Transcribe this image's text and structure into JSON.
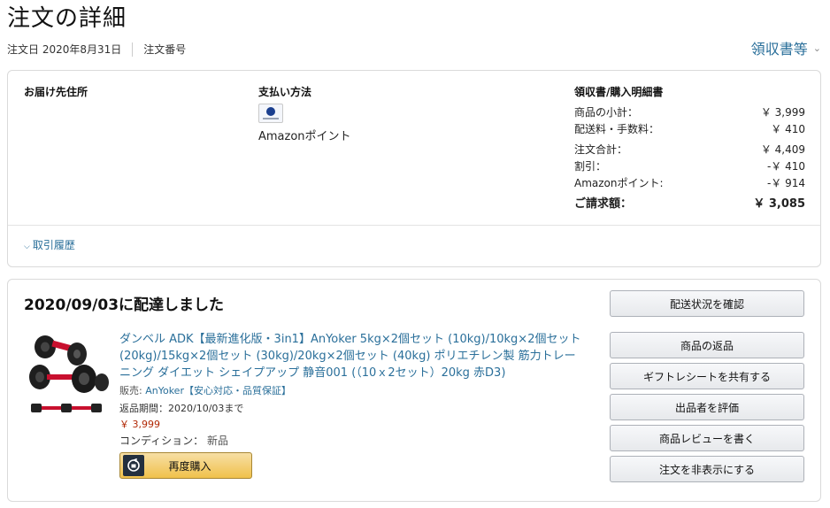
{
  "header": {
    "title": "注文の詳細",
    "order_date_label": "注文日",
    "order_date": "2020年8月31日",
    "order_number_label": "注文番号",
    "receipt_link": "領収書等"
  },
  "summary": {
    "shipping_address_label": "お届け先住所",
    "payment_method_label": "支払い方法",
    "payment_method": "Amazonポイント",
    "payment_icon": "card-icon",
    "receipt_heading": "領収書/購入明細書",
    "rows": [
      {
        "label": "商品の小計：",
        "value": "￥ 3,999"
      },
      {
        "label": "配送料・手数料：",
        "value": "￥ 410"
      },
      {
        "label": "注文合計：",
        "value": "￥ 4,409"
      },
      {
        "label": "割引：",
        "value": "-￥ 410"
      },
      {
        "label": "Amazonポイント:",
        "value": "-￥ 914"
      }
    ],
    "grand_total_label": "ご請求額：",
    "grand_total": "￥ 3,085",
    "history_link": "取引履歴"
  },
  "shipment": {
    "status": "2020/09/03に配達しました",
    "product": {
      "title": "ダンベル ADK【最新進化版・3in1】AnYoker 5kg×2個セット (10kg)/10kg×2個セット (20kg)/15kg×2個セット (30kg)/20kg×2個セット (40kg) ポリエチレン製 筋力トレーニング ダイエット シェイプアップ 静音001 (（10ｘ2セット）20kg 赤D3)",
      "seller_label": "販売:",
      "seller": "AnYoker【安心対応・品質保証】",
      "return_deadline": "返品期間：2020/10/03まで",
      "price": "￥ 3,999",
      "condition_label": "コンディション：",
      "condition": "新品",
      "rebuy_label": "再度購入",
      "image": "dumbbell-set-image"
    },
    "actions": {
      "track": "配送状況を確認",
      "return": "商品の返品",
      "gift_receipt": "ギフトレシートを共有する",
      "rate_seller": "出品者を評価",
      "write_review": "商品レビューを書く",
      "hide_order": "注文を非表示にする"
    }
  },
  "colors": {
    "link": "#2a6f9a",
    "price": "#b12704",
    "primary_button": "#f0c14b"
  }
}
